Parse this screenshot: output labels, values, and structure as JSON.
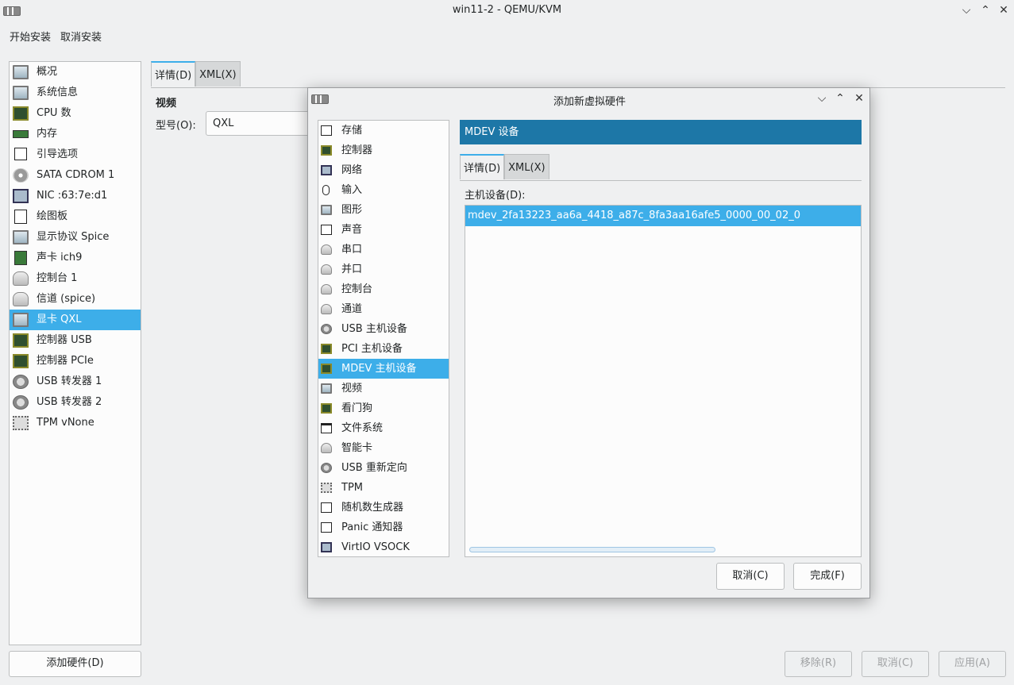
{
  "window": {
    "title": "win11-2 - QEMU/KVM",
    "controls": [
      "minimize-icon",
      "maximize-icon",
      "close-icon"
    ]
  },
  "menu": [
    "开始安装",
    "取消安装"
  ],
  "hardware_list": [
    {
      "label": "概况",
      "icon": "monitor-icon"
    },
    {
      "label": "系统信息",
      "icon": "monitor-icon"
    },
    {
      "label": "CPU 数",
      "icon": "cpu-icon"
    },
    {
      "label": "内存",
      "icon": "memory-icon"
    },
    {
      "label": "引导选项",
      "icon": "boot-icon"
    },
    {
      "label": "SATA CDROM 1",
      "icon": "cdrom-icon"
    },
    {
      "label": "NIC :63:7e:d1",
      "icon": "network-icon"
    },
    {
      "label": "绘图板",
      "icon": "tablet-icon"
    },
    {
      "label": "显示协议 Spice",
      "icon": "display-icon"
    },
    {
      "label": "声卡 ich9",
      "icon": "sound-card-icon"
    },
    {
      "label": "控制台 1",
      "icon": "serial-icon"
    },
    {
      "label": "信道 (spice)",
      "icon": "channel-icon"
    },
    {
      "label": "显卡 QXL",
      "icon": "video-icon",
      "selected": true
    },
    {
      "label": "控制器 USB",
      "icon": "controller-icon"
    },
    {
      "label": "控制器 PCIe",
      "icon": "controller-icon"
    },
    {
      "label": "USB 转发器 1",
      "icon": "usb-icon"
    },
    {
      "label": "USB 转发器 2",
      "icon": "usb-icon"
    },
    {
      "label": "TPM vNone",
      "icon": "tpm-icon"
    }
  ],
  "add_hardware_button": "添加硬件(D)",
  "main_tabs": [
    "详情(D)",
    "XML(X)"
  ],
  "video_section": {
    "title": "视频",
    "model_label": "型号(O):",
    "model_value": "QXL"
  },
  "bottom_buttons": {
    "remove": "移除(R)",
    "cancel": "取消(C)",
    "apply": "应用(A)"
  },
  "dialog": {
    "title": "添加新虚拟硬件",
    "device_list": [
      {
        "label": "存储",
        "icon": "storage-icon"
      },
      {
        "label": "控制器",
        "icon": "controller-icon"
      },
      {
        "label": "网络",
        "icon": "network-icon"
      },
      {
        "label": "输入",
        "icon": "mouse-icon"
      },
      {
        "label": "图形",
        "icon": "graphics-icon"
      },
      {
        "label": "声音",
        "icon": "sound-icon"
      },
      {
        "label": "串口",
        "icon": "serial-icon"
      },
      {
        "label": "并口",
        "icon": "parallel-icon"
      },
      {
        "label": "控制台",
        "icon": "console-icon"
      },
      {
        "label": "通道",
        "icon": "channel-icon"
      },
      {
        "label": "USB 主机设备",
        "icon": "usb-icon"
      },
      {
        "label": "PCI 主机设备",
        "icon": "pci-icon"
      },
      {
        "label": "MDEV 主机设备",
        "icon": "mdev-icon",
        "selected": true
      },
      {
        "label": "视频",
        "icon": "video-icon"
      },
      {
        "label": "看门狗",
        "icon": "watchdog-icon"
      },
      {
        "label": "文件系统",
        "icon": "folder-icon"
      },
      {
        "label": "智能卡",
        "icon": "smartcard-icon"
      },
      {
        "label": "USB 重新定向",
        "icon": "usb-redirect-icon"
      },
      {
        "label": "TPM",
        "icon": "tpm-icon"
      },
      {
        "label": "随机数生成器",
        "icon": "rng-icon"
      },
      {
        "label": "Panic 通知器",
        "icon": "panic-icon"
      },
      {
        "label": "VirtIO VSOCK",
        "icon": "vsock-icon"
      }
    ],
    "header": "MDEV 设备",
    "tabs": [
      "详情(D)",
      "XML(X)"
    ],
    "host_device_label": "主机设备(D):",
    "host_devices": [
      "mdev_2fa13223_aa6a_4418_a87c_8fa3aa16afe5_0000_00_02_0"
    ],
    "cancel_button": "取消(C)",
    "finish_button": "完成(F)"
  },
  "colors": {
    "accent": "#3daee9",
    "header_bg": "#1d77a7",
    "window_bg": "#eff0f1"
  }
}
